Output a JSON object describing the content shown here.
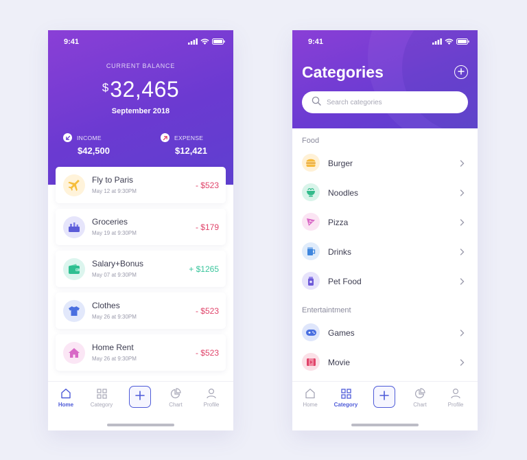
{
  "status_bar": {
    "time": "9:41"
  },
  "home": {
    "balance_label": "CURRENT BALANCE",
    "currency_symbol": "$",
    "balance": "32,465",
    "period": "September 2018",
    "income": {
      "label": "INCOME",
      "value": "$42,500"
    },
    "expense": {
      "label": "EXPENSE",
      "value": "$12,421"
    },
    "transactions": [
      {
        "title": "Fly to Paris",
        "date": "May 12 at 9:30PM",
        "amount": "- $523",
        "icon": "airplane-icon"
      },
      {
        "title": "Groceries",
        "date": "May 19 at 9:30PM",
        "amount": "- $179",
        "icon": "groceries-icon"
      },
      {
        "title": "Salary+Bonus",
        "date": "May 07 at 9:30PM",
        "amount": "+ $1265",
        "icon": "wallet-icon"
      },
      {
        "title": "Clothes",
        "date": "May 26 at 9:30PM",
        "amount": "- $523",
        "icon": "tshirt-icon"
      },
      {
        "title": "Home Rent",
        "date": "May 26 at 9:30PM",
        "amount": "- $523",
        "icon": "house-icon"
      }
    ]
  },
  "categories_screen": {
    "title": "Categories",
    "search_placeholder": "Search categories",
    "sections": [
      {
        "title": "Food",
        "items": [
          {
            "label": "Burger",
            "icon": "burger-icon"
          },
          {
            "label": "Noodles",
            "icon": "noodles-icon"
          },
          {
            "label": "Pizza",
            "icon": "pizza-icon"
          },
          {
            "label": "Drinks",
            "icon": "drink-icon"
          },
          {
            "label": "Pet Food",
            "icon": "pet-food-icon"
          }
        ]
      },
      {
        "title": "Entertaintment",
        "items": [
          {
            "label": "Games",
            "icon": "gamepad-icon"
          },
          {
            "label": "Movie",
            "icon": "film-icon"
          }
        ]
      }
    ]
  },
  "nav": {
    "home": "Home",
    "category": "Category",
    "chart": "Chart",
    "profile": "Profile"
  },
  "colors": {
    "header_gradient_start": "#8a3fd6",
    "header_gradient_end": "#5e3fcf",
    "accent": "#4d5ad8",
    "negative": "#e0446a",
    "positive": "#39c59c"
  }
}
